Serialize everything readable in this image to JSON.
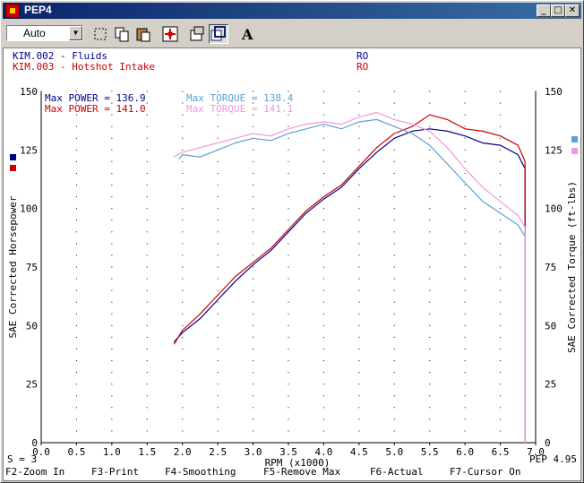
{
  "window": {
    "title": "PEP4"
  },
  "toolbar": {
    "combo_value": "Auto",
    "tools": [
      "select-icon",
      "copy-icon",
      "paste-icon",
      "zoom-fit-icon",
      "properties-icon",
      "overlay-icon",
      "text-icon"
    ]
  },
  "runs": [
    {
      "name": "KIM.002 - Fluids",
      "code": "RO",
      "color": "#00008b"
    },
    {
      "name": "KIM.003 - Hotshot Intake",
      "code": "RO",
      "color": "#cc0000"
    }
  ],
  "max_labels": [
    {
      "power": "Max POWER = 136.9",
      "torque": "Max TORQUE = 138.4",
      "power_color": "#00008b",
      "torque_color": "#5aa0d8"
    },
    {
      "power": "Max POWER = 141.0",
      "torque": "Max TORQUE = 141.1",
      "power_color": "#cc0000",
      "torque_color": "#ee99dd"
    }
  ],
  "footer": {
    "smoothing": "S = 3",
    "version": "PEP 4.95",
    "keys": [
      "F2-Zoom In",
      "F3-Print",
      "F4-Smoothing",
      "F5-Remove Max",
      "F6-Actual",
      "F7-Cursor On"
    ]
  },
  "chart_data": {
    "type": "line",
    "xlabel": "RPM (x1000)",
    "ylabel": "SAE Corrected Horsepower",
    "y2label": "SAE Corrected Torque (ft-lbs)",
    "xlim": [
      0,
      7.0
    ],
    "ylim": [
      0,
      150
    ],
    "x_ticks": [
      "0.0",
      "0.5",
      "1.0",
      "1.5",
      "2.0",
      "2.5",
      "3.0",
      "3.5",
      "4.0",
      "4.5",
      "5.0",
      "5.5",
      "6.0",
      "6.5",
      "7.0"
    ],
    "y_ticks": [
      "0",
      "25",
      "50",
      "75",
      "100",
      "125",
      "150"
    ],
    "grid": true,
    "series": [
      {
        "color": "#00008b",
        "x": [
          1.88,
          2.0,
          2.25,
          2.5,
          2.75,
          3.0,
          3.25,
          3.5,
          3.75,
          4.0,
          4.25,
          4.5,
          4.75,
          5.0,
          5.25,
          5.5,
          5.75,
          6.0,
          6.25,
          6.5,
          6.75,
          6.85
        ],
        "y": [
          43,
          47,
          53,
          61,
          69,
          76,
          82,
          90,
          98,
          104,
          109,
          117,
          124,
          130,
          133,
          134,
          133,
          131,
          128,
          127,
          123,
          117
        ]
      },
      {
        "color": "#cc0000",
        "x": [
          1.88,
          2.0,
          2.25,
          2.5,
          2.75,
          3.0,
          3.25,
          3.5,
          3.75,
          4.0,
          4.25,
          4.5,
          4.75,
          5.0,
          5.25,
          5.5,
          5.75,
          6.0,
          6.25,
          6.5,
          6.75,
          6.85
        ],
        "y": [
          42,
          48,
          55,
          63,
          71,
          77,
          83,
          91,
          99,
          105,
          110,
          118,
          126,
          132,
          135,
          140,
          138,
          134,
          133,
          131,
          127,
          120
        ]
      },
      {
        "color": "#5aa0d8",
        "x": [
          1.95,
          2.0,
          2.25,
          2.5,
          2.75,
          3.0,
          3.25,
          3.5,
          3.75,
          4.0,
          4.25,
          4.5,
          4.75,
          5.0,
          5.25,
          5.5,
          5.75,
          6.0,
          6.25,
          6.5,
          6.75,
          6.85
        ],
        "y": [
          121,
          123,
          122,
          125,
          128,
          130,
          129,
          132,
          134,
          136,
          134,
          137,
          138,
          135,
          132,
          127,
          119,
          111,
          103,
          98,
          93,
          88
        ]
      },
      {
        "color": "#ee99dd",
        "x": [
          1.88,
          2.0,
          2.25,
          2.5,
          2.75,
          3.0,
          3.25,
          3.5,
          3.75,
          4.0,
          4.25,
          4.5,
          4.75,
          5.0,
          5.25,
          5.5,
          5.75,
          6.0,
          6.25,
          6.5,
          6.75,
          6.85
        ],
        "y": [
          122,
          124,
          126,
          128,
          130,
          132,
          131,
          134,
          136,
          137,
          136,
          139,
          141,
          138,
          136,
          133,
          126,
          117,
          109,
          103,
          97,
          92
        ]
      }
    ]
  }
}
